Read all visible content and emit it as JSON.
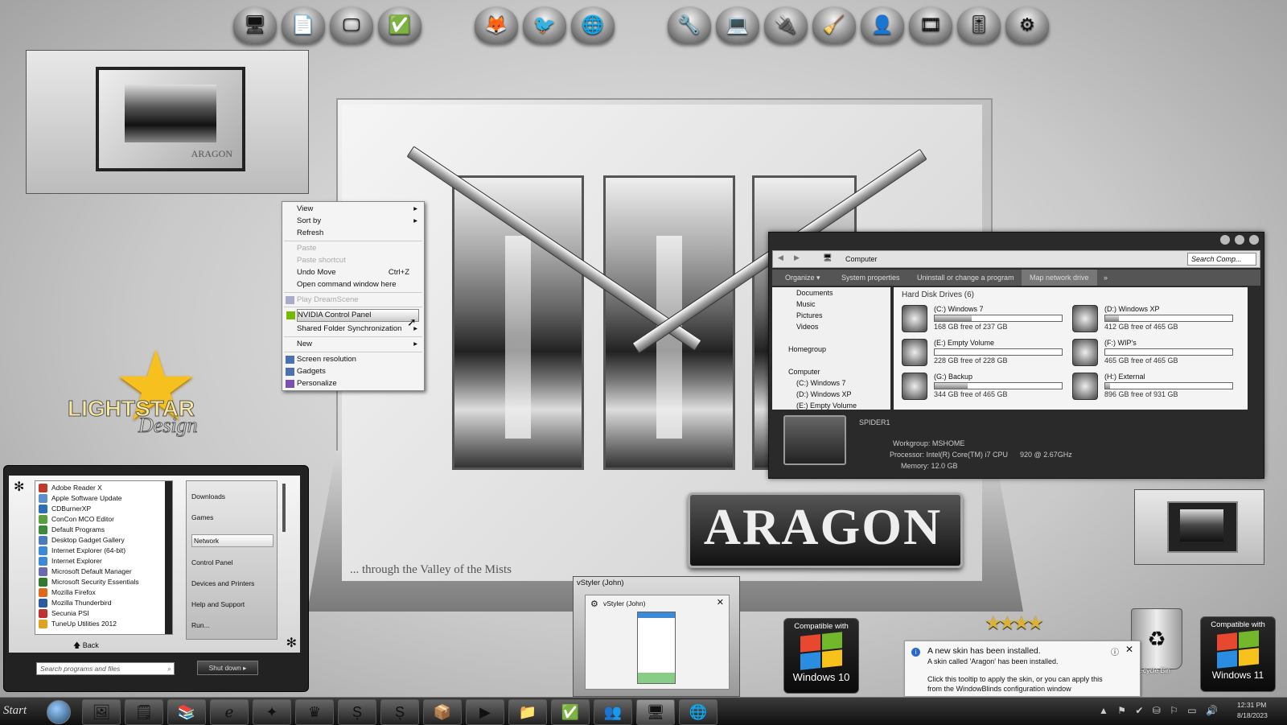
{
  "context_menu": {
    "items": [
      {
        "label": "View",
        "arrow": "▸"
      },
      {
        "label": "Sort by",
        "arrow": "▸"
      },
      {
        "label": "Refresh"
      },
      {
        "label": "Paste",
        "disabled": true
      },
      {
        "label": "Paste shortcut",
        "disabled": true
      },
      {
        "label": "Undo Move",
        "shortcut": "Ctrl+Z"
      },
      {
        "label": "Open command window here"
      },
      {
        "label": "Play DreamScene",
        "disabled": true
      },
      {
        "label": "NVIDIA Control Panel"
      },
      {
        "label": "Shared Folder Synchronization",
        "arrow": "▸"
      },
      {
        "label": "New",
        "arrow": "▸"
      },
      {
        "label": "Screen resolution"
      },
      {
        "label": "Gadgets"
      },
      {
        "label": "Personalize"
      }
    ]
  },
  "explorer": {
    "address": "Computer",
    "search_placeholder": "Search Comp...",
    "toolbar": [
      "Organize ▾",
      "System properties",
      "Uninstall or change a program",
      "Map network drive",
      "»"
    ],
    "nav": [
      "Documents",
      "Music",
      "Pictures",
      "Videos",
      "Homegroup",
      "Computer",
      "(C:) Windows 7",
      "(D:) Windows XP",
      "(E:) Empty Volume"
    ],
    "group_header": "Hard Disk Drives (6)",
    "drives": [
      {
        "name": "(C:) Windows 7",
        "free": "168 GB free of 237 GB",
        "used": 0.29
      },
      {
        "name": "(D:) Windows XP",
        "free": "412 GB free of 465 GB",
        "used": 0.11
      },
      {
        "name": "(E:) Empty Volume",
        "free": "228 GB free of 228 GB",
        "used": 0.0
      },
      {
        "name": "(F:) WIP's",
        "free": "465 GB free of 465 GB",
        "used": 0.0
      },
      {
        "name": "(G:) Backup",
        "free": "344 GB free of 465 GB",
        "used": 0.26
      },
      {
        "name": "(H:) External",
        "free": "896 GB free of 931 GB",
        "used": 0.04
      }
    ],
    "computer_name": "SPIDER1",
    "details": [
      {
        "k": "Workgroup:",
        "v": "MSHOME"
      },
      {
        "k": "Processor:",
        "v": "Intel(R) Core(TM) i7 CPU      920 @ 2.67GHz"
      },
      {
        "k": "Memory:",
        "v": "12.0 GB"
      }
    ]
  },
  "start_menu": {
    "programs": [
      "Adobe Reader X",
      "Apple Software Update",
      "CDBurnerXP",
      "ConCon MCO Editor",
      "Default Programs",
      "Desktop Gadget Gallery",
      "Internet Explorer (64-bit)",
      "Internet Explorer",
      "Microsoft Default Manager",
      "Microsoft Security Essentials",
      "Mozilla Firefox",
      "Mozilla Thunderbird",
      "Secunia PSI",
      "TuneUp Utilities 2012"
    ],
    "places": [
      "Downloads",
      "Games",
      "Network",
      "Control Panel",
      "Devices and Printers",
      "Help and Support",
      "Run..."
    ],
    "back_label": "Back",
    "search_placeholder": "Search programs and files",
    "shutdown_label": "Shut down"
  },
  "art": {
    "brand": "ARAGON",
    "tagline": "... through the Valley of the Mists",
    "preview_brand": "ARAGON",
    "logo_top": "LIGHTSTAR",
    "logo_bottom": "Design"
  },
  "thumbnail": {
    "header": "vStyler (John)",
    "title": "vStyler (John)"
  },
  "compat": [
    {
      "top": "Compatible with",
      "bottom": "Windows 10"
    },
    {
      "top": "Compatible with",
      "bottom": "Windows 11"
    }
  ],
  "notification": {
    "title": "A new skin has been installed.",
    "line1": "A skin called 'Aragon' has been installed.",
    "line2": "Click this tooltip to apply the skin, or you can apply this",
    "line3": "from the WindowBlinds configuration window"
  },
  "recycle_label": "Recycle Bin",
  "taskbar": {
    "start_label": "Start",
    "time": "12:31 PM",
    "date": "8/18/2023"
  },
  "colors": {
    "flag_red": "#e8482f",
    "flag_green": "#73b82a",
    "flag_blue": "#2b8de0",
    "flag_yellow": "#f7c21b"
  }
}
